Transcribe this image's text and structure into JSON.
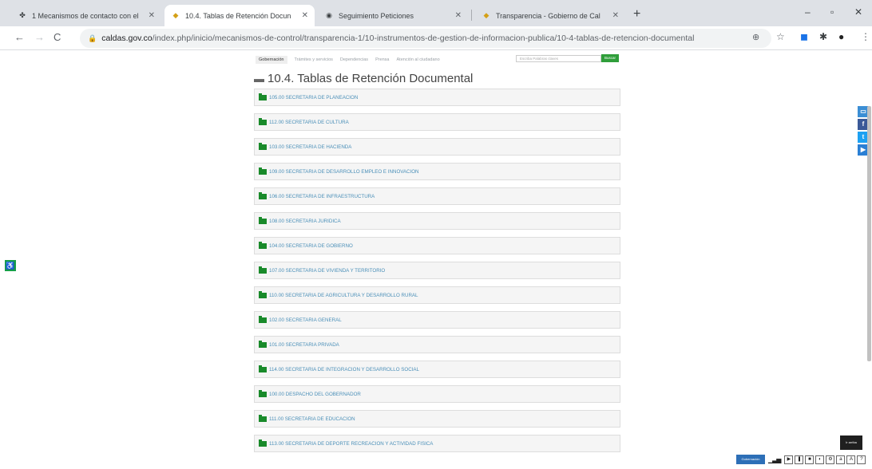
{
  "browser": {
    "tabs": [
      {
        "title": "1 Mecanismos de contacto con el",
        "favicon": "caldas-favicon",
        "active": false
      },
      {
        "title": "10.4. Tablas de Retención Docun",
        "favicon": "caldas-shield-favicon",
        "active": true
      },
      {
        "title": "Seguimiento Peticiones",
        "favicon": "globe-icon",
        "active": false
      },
      {
        "title": "Transparencia - Gobierno de Cal",
        "favicon": "caldas-shield-favicon",
        "active": false
      }
    ],
    "new_tab": "+",
    "window_controls": {
      "minimize": "–",
      "maximize": "▫",
      "close": "✕"
    },
    "nav": {
      "back": "←",
      "forward": "→",
      "reload": "C"
    },
    "url_host": "caldas.gov.co",
    "url_path": "/index.php/inicio/mecanismos-de-control/transparencia-1/10-instrumentos-de-gestion-de-informacion-publica/10-4-tablas-de-retencion-documental"
  },
  "site": {
    "nav_items": [
      "Gobernación",
      "Trámites y servicios",
      "Dependencias",
      "Prensa",
      "Atención al ciudadano"
    ],
    "search_placeholder": "Escriba Palabras claves",
    "search_button": "Buscar",
    "page_title": "10.4. Tablas de Retención Documental",
    "folders": [
      "105.00 SECRETARIA DE PLANEACION",
      "112.00 SECRETARIA DE CULTURA",
      "103.00 SECRETARIA DE HACIENDA",
      "109.00 SECRETARIA DE DESARROLLO EMPLEO E INNOVACION",
      "106.00 SECRETARIA DE INFRAESTRUCTURA",
      "108.00 SECRETARIA JURIDICA",
      "104.00 SECRETARIA DE GOBIERNO",
      "107.00 SECRETARIA DE VIVIENDA Y TERRITORIO",
      "110.00 SECRETARIA DE AGRICULTURA Y DESARROLLO RURAL",
      "102.00 SECRETARIA GENERAL",
      "101.00 SECRETARIA PRIVADA",
      "114.00 SECRETARIA DE INTEGRACION Y DESARROLLO SOCIAL",
      "100.00 DESPACHO DEL GOBERNADOR",
      "111.00 SECRETARIA DE EDUCACION",
      "113.00 SECRETARIA DE DEPORTE RECREACION Y ACTIVIDAD FISICA"
    ],
    "share_buttons": [
      {
        "icon": "chat-icon",
        "glyph": "▭",
        "color": "#3b8ed4"
      },
      {
        "icon": "facebook-icon",
        "glyph": "f",
        "color": "#3b5998"
      },
      {
        "icon": "twitter-icon",
        "glyph": "t",
        "color": "#1da1f2"
      },
      {
        "icon": "youtube-icon",
        "glyph": "▶",
        "color": "#2a7fd4"
      }
    ],
    "accessibility_glyph": "♿",
    "chat_badge": "Ir arriba",
    "footer_logo": "Gobernación",
    "colors": {
      "folder_icon": "#198a2a",
      "link_text": "#4a8fb8",
      "search_button": "#2f9e3a"
    }
  }
}
